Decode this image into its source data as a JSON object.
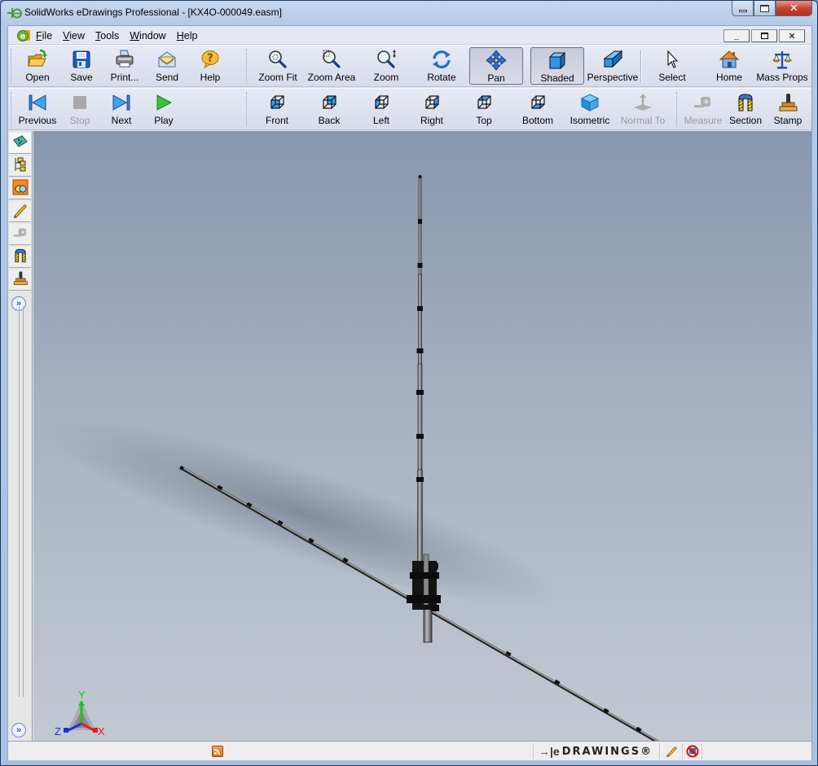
{
  "window": {
    "title": "SolidWorks eDrawings Professional - [KX4O-000049.easm]",
    "app_icon": "edrawings-logo-icon",
    "caption_buttons": [
      "minimize",
      "maximize",
      "close"
    ]
  },
  "menubar": {
    "items": [
      {
        "label": "File",
        "accel": "F"
      },
      {
        "label": "View",
        "accel": "V"
      },
      {
        "label": "Tools",
        "accel": "T"
      },
      {
        "label": "Window",
        "accel": "W"
      },
      {
        "label": "Help",
        "accel": "H"
      }
    ],
    "mdi_buttons": {
      "minimize": "_",
      "restore": "🗗",
      "close": "✕"
    }
  },
  "toolbar_file": [
    {
      "label": "Open",
      "icon": "open-folder-icon"
    },
    {
      "label": "Save",
      "icon": "save-disk-icon"
    },
    {
      "label": "Print...",
      "icon": "printer-icon"
    },
    {
      "label": "Send",
      "icon": "envelope-icon"
    },
    {
      "label": "Help",
      "icon": "help-question-icon"
    }
  ],
  "toolbar_view": [
    {
      "label": "Zoom Fit",
      "icon": "zoom-fit-icon"
    },
    {
      "label": "Zoom Area",
      "icon": "zoom-area-icon"
    },
    {
      "label": "Zoom",
      "icon": "zoom-icon"
    },
    {
      "label": "Rotate",
      "icon": "rotate-icon"
    },
    {
      "label": "Pan",
      "icon": "pan-icon",
      "pressed": true
    },
    {
      "label": "Shaded",
      "icon": "shaded-cube-icon",
      "pressed": true
    },
    {
      "label": "Perspective",
      "icon": "perspective-box-icon"
    },
    {
      "label": "Select",
      "icon": "select-cursor-icon"
    },
    {
      "label": "Home",
      "icon": "home-icon"
    },
    {
      "label": "Mass Props",
      "icon": "mass-props-scale-icon"
    }
  ],
  "toolbar_animation": [
    {
      "label": "Previous",
      "icon": "previous-icon"
    },
    {
      "label": "Stop",
      "icon": "stop-icon",
      "disabled": true
    },
    {
      "label": "Next",
      "icon": "next-icon"
    },
    {
      "label": "Play",
      "icon": "play-icon"
    }
  ],
  "toolbar_orientation": [
    {
      "label": "Front",
      "icon": "view-front-icon"
    },
    {
      "label": "Back",
      "icon": "view-back-icon"
    },
    {
      "label": "Left",
      "icon": "view-left-icon"
    },
    {
      "label": "Right",
      "icon": "view-right-icon"
    },
    {
      "label": "Top",
      "icon": "view-top-icon"
    },
    {
      "label": "Bottom",
      "icon": "view-bottom-icon"
    },
    {
      "label": "Isometric",
      "icon": "view-isometric-icon"
    },
    {
      "label": "Normal To",
      "icon": "normal-to-icon",
      "disabled": true
    }
  ],
  "toolbar_tools": [
    {
      "label": "Measure",
      "icon": "measure-tape-icon",
      "disabled": true
    },
    {
      "label": "Section",
      "icon": "section-icon"
    },
    {
      "label": "Stamp",
      "icon": "stamp-icon"
    }
  ],
  "left_panel": {
    "tabs": [
      "model-tree-icon",
      "components-tree-icon",
      "configurations-icon",
      "markup-pencil-icon",
      "measure-tape-icon",
      "section-icon",
      "stamp-icon"
    ],
    "expand_label": "»"
  },
  "viewport": {
    "model": "vertical antenna with horizontal radials",
    "triad": {
      "x_label": "X",
      "y_label": "Y",
      "z_label": "Z",
      "x_color": "#e02020",
      "y_color": "#20c020",
      "z_color": "#2020e0"
    }
  },
  "statusbar": {
    "rss_icon": "rss-feed-icon",
    "brand": "DRAWINGS®",
    "brand_prefix": "→|e",
    "markup_icon": "markup-pencil-icon",
    "no_network_icon": "no-network-icon"
  },
  "colors": {
    "accent_blue": "#1e62d0",
    "disabled_text": "#9a9a9a"
  }
}
